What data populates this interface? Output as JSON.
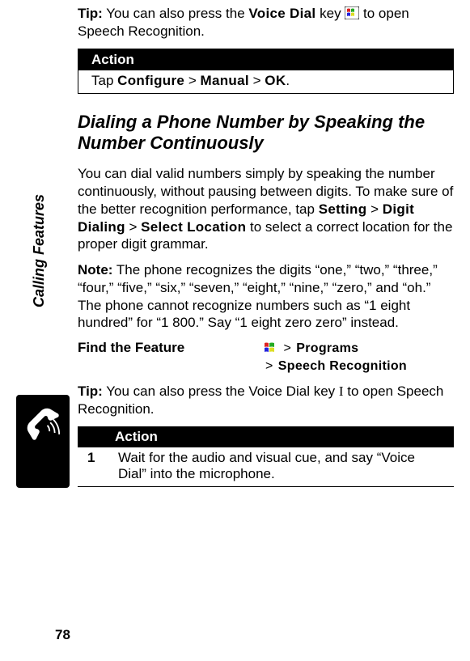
{
  "sidebar": {
    "label": "Calling Features"
  },
  "page_number": "78",
  "tip1": {
    "label": "Tip:",
    "part1": " You can also press the ",
    "key": "Voice Dial",
    "part2": " key ",
    "part3": " to open Speech Recognition."
  },
  "action1": {
    "header": "Action",
    "tap": "Tap ",
    "path1": "Configure",
    "gt": ">",
    "path2": "Manual",
    "path3": "OK",
    "period": "."
  },
  "heading": "Dialing a Phone Number by Speaking the Number Continuously",
  "para1": {
    "part1": "You can dial valid numbers simply by speaking the number continuously, without pausing between digits. To make sure of the better recognition performance, tap ",
    "p1": "Setting",
    "gt": " > ",
    "p2": "Digit Dialing",
    "p3": "Select Location",
    "part2": " to select a correct location for the proper digit grammar."
  },
  "note": {
    "label": "Note:",
    "text": " The phone recognizes the digits “one,” “two,” “three,” “four,” “five,” “six,” “seven,” “eight,” “nine,” “zero,” and “oh.” The phone cannot recognize numbers such as “1 eight hundred” for “1 800.” Say “1 eight zero zero” instead."
  },
  "feature": {
    "label": "Find the Feature",
    "gt": ">",
    "p1": "Programs",
    "p2": "Speech Recognition"
  },
  "tip2": {
    "label": "Tip:",
    "part1": " You can also press the Voice Dial key ",
    "key_glyph": "I",
    "part2": " to open Speech Recognition."
  },
  "action2": {
    "header": "Action",
    "num": "1",
    "text": "Wait for the audio and visual cue, and say “Voice Dial” into the microphone."
  }
}
